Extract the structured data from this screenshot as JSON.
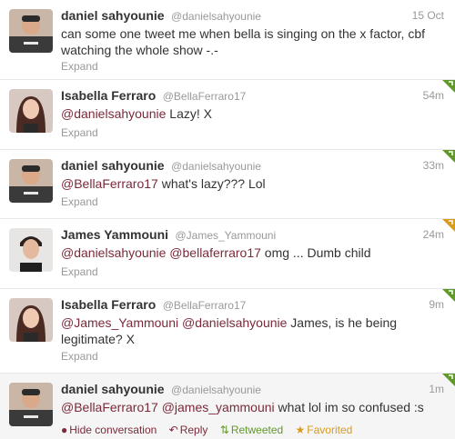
{
  "tweets": [
    {
      "name": "daniel sahyounie",
      "handle": "@danielsahyounie",
      "time": "15 Oct",
      "text_line1": "can some one tweet me when bella is singing on the x factor, cbf",
      "text_line2": "watching the whole show -.-",
      "expand": "Expand"
    },
    {
      "name": "Isabella Ferraro",
      "handle": "@BellaFerraro17",
      "time": "54m",
      "mention1": "@danielsahyounie",
      "text": " Lazy! X",
      "expand": "Expand"
    },
    {
      "name": "daniel sahyounie",
      "handle": "@danielsahyounie",
      "time": "33m",
      "mention1": "@BellaFerraro17",
      "text": " what's lazy??? Lol",
      "expand": "Expand"
    },
    {
      "name": "James Yammouni",
      "handle": "@James_Yammouni",
      "time": "24m",
      "mention1": "@danielsahyounie",
      "mention2": "@bellaferraro17",
      "text": " omg ... Dumb child",
      "expand": "Expand"
    },
    {
      "name": "Isabella Ferraro",
      "handle": "@BellaFerraro17",
      "time": "9m",
      "mention1": "@James_Yammouni",
      "mention2": "@danielsahyounie",
      "text": " James, is he being",
      "text_line2": "legitimate? X",
      "expand": "Expand"
    },
    {
      "name": "daniel sahyounie",
      "handle": "@danielsahyounie",
      "time": "1m",
      "mention1": "@BellaFerraro17",
      "mention2": "@james_yammouni",
      "text": " what lol im so confused :s",
      "actions": {
        "hide": "Hide conversation",
        "reply": "Reply",
        "retweeted": "Retweeted",
        "favorited": "Favorited"
      }
    }
  ],
  "colors": {
    "link": "#7b2a3a",
    "retweet": "#609928",
    "favorite": "#d89b1c",
    "muted": "#999999"
  },
  "icons": {
    "retweet_corner": "retweet-corner-icon",
    "hide": "hide-conversation-icon",
    "reply": "reply-icon",
    "retweeted": "retweeted-icon",
    "favorited": "favorite-star-icon"
  }
}
